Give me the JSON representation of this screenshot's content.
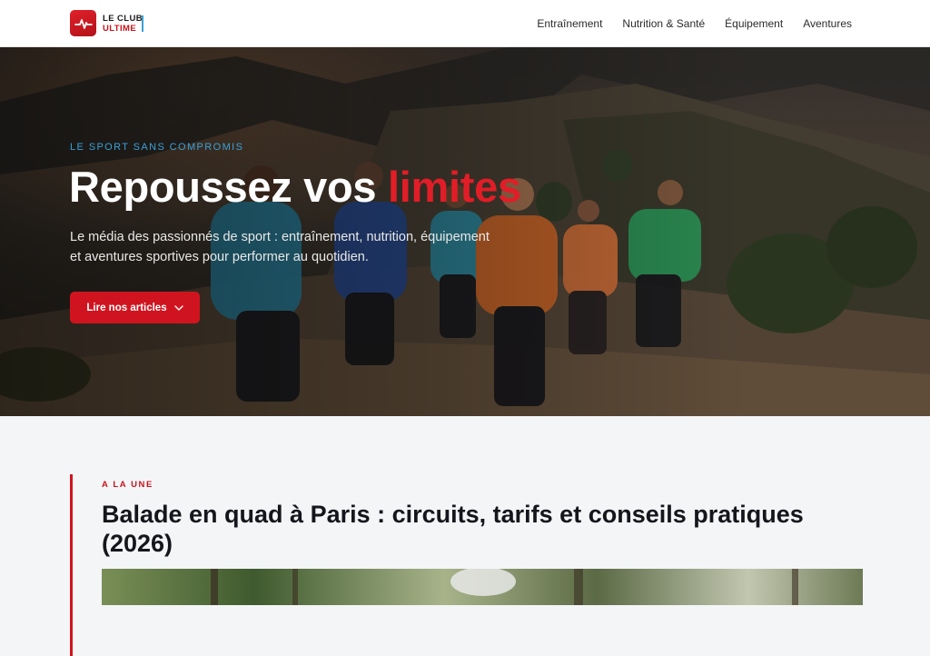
{
  "brand": {
    "line1": "LE CLUB",
    "line2": "ULTIME",
    "logo_icon": "heartbeat-icon",
    "accent_color": "#d0141f",
    "secondary_color": "#3aa0d8"
  },
  "nav": {
    "items": [
      {
        "label": "Entraînement"
      },
      {
        "label": "Nutrition & Santé"
      },
      {
        "label": "Équipement"
      },
      {
        "label": "Aventures"
      }
    ]
  },
  "hero": {
    "eyebrow": "LE SPORT SANS COMPROMIS",
    "title_main": "Repoussez vos ",
    "title_accent": "limites",
    "description": "Le média des passionnés de sport : entraînement, nutrition, équipement et aventures sportives pour performer au quotidien.",
    "cta_label": "Lire nos articles",
    "cta_icon": "chevron-down-icon"
  },
  "featured": {
    "kicker": "A LA UNE",
    "title": "Balade en quad à Paris : circuits, tarifs et conseils pratiques (2026)"
  }
}
